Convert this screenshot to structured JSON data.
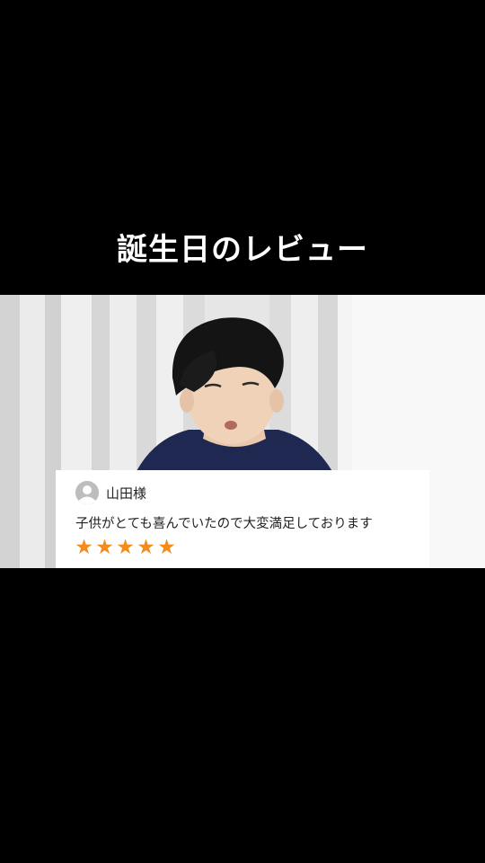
{
  "title": "誕生日のレビュー",
  "review": {
    "reviewer_name": "山田様",
    "text": "子供がとても喜んでいたので大変満足しております",
    "rating": 5,
    "rating_max": 5,
    "star_color": "#f28c1e",
    "avatar_icon": "user-avatar-icon"
  },
  "colors": {
    "background": "#000000",
    "card": "#ffffff",
    "title_text": "#ffffff",
    "shirt": "#1f2850",
    "curtain": "#e8e8e8"
  }
}
